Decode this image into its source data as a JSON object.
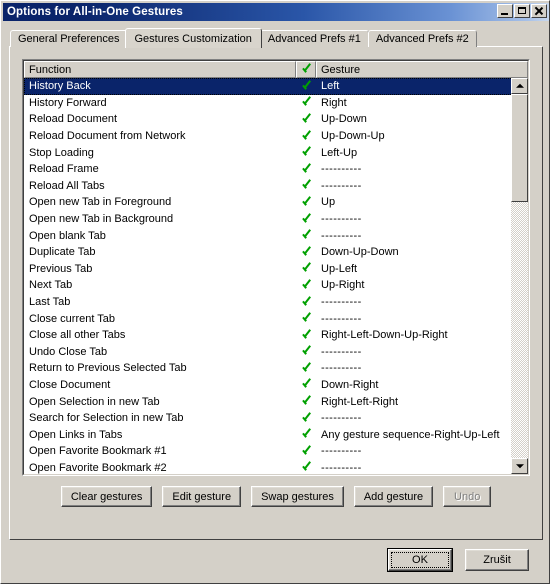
{
  "window": {
    "title": "Options for All-in-One Gestures",
    "controls": {
      "minimize": "Minimize",
      "maximize": "Maximize",
      "close": "Close"
    }
  },
  "tabs": [
    {
      "label": "General Preferences",
      "active": false
    },
    {
      "label": "Gestures Customization",
      "active": true
    },
    {
      "label": "Advanced Prefs #1",
      "active": false
    },
    {
      "label": "Advanced Prefs #2",
      "active": false
    }
  ],
  "list": {
    "columns": {
      "function": "Function",
      "enabled_icon": "check-icon",
      "gesture": "Gesture"
    },
    "placeholder_gesture": "----------",
    "rows": [
      {
        "function": "History Back",
        "enabled": true,
        "gesture": "Left",
        "selected": true
      },
      {
        "function": "History Forward",
        "enabled": true,
        "gesture": "Right",
        "selected": false
      },
      {
        "function": "Reload Document",
        "enabled": true,
        "gesture": "Up-Down",
        "selected": false
      },
      {
        "function": "Reload Document from Network",
        "enabled": true,
        "gesture": "Up-Down-Up",
        "selected": false
      },
      {
        "function": "Stop Loading",
        "enabled": true,
        "gesture": "Left-Up",
        "selected": false
      },
      {
        "function": "Reload Frame",
        "enabled": true,
        "gesture": "----------",
        "selected": false
      },
      {
        "function": "Reload All Tabs",
        "enabled": true,
        "gesture": "----------",
        "selected": false
      },
      {
        "function": "Open new Tab in Foreground",
        "enabled": true,
        "gesture": "Up",
        "selected": false
      },
      {
        "function": "Open new Tab in Background",
        "enabled": true,
        "gesture": "----------",
        "selected": false
      },
      {
        "function": "Open blank Tab",
        "enabled": true,
        "gesture": "----------",
        "selected": false
      },
      {
        "function": "Duplicate Tab",
        "enabled": true,
        "gesture": "Down-Up-Down",
        "selected": false
      },
      {
        "function": "Previous Tab",
        "enabled": true,
        "gesture": "Up-Left",
        "selected": false
      },
      {
        "function": "Next Tab",
        "enabled": true,
        "gesture": "Up-Right",
        "selected": false
      },
      {
        "function": "Last Tab",
        "enabled": true,
        "gesture": "----------",
        "selected": false
      },
      {
        "function": "Close current Tab",
        "enabled": true,
        "gesture": "----------",
        "selected": false
      },
      {
        "function": "Close all other Tabs",
        "enabled": true,
        "gesture": "Right-Left-Down-Up-Right",
        "selected": false
      },
      {
        "function": "Undo Close Tab",
        "enabled": true,
        "gesture": "----------",
        "selected": false
      },
      {
        "function": "Return to Previous Selected Tab",
        "enabled": true,
        "gesture": "----------",
        "selected": false
      },
      {
        "function": "Close Document",
        "enabled": true,
        "gesture": "Down-Right",
        "selected": false
      },
      {
        "function": "Open Selection in new Tab",
        "enabled": true,
        "gesture": "Right-Left-Right",
        "selected": false
      },
      {
        "function": "Search for Selection in new Tab",
        "enabled": true,
        "gesture": "----------",
        "selected": false
      },
      {
        "function": "Open Links in Tabs",
        "enabled": true,
        "gesture": "Any gesture sequence-Right-Up-Left",
        "selected": false
      },
      {
        "function": "Open Favorite Bookmark #1",
        "enabled": true,
        "gesture": "----------",
        "selected": false
      },
      {
        "function": "Open Favorite Bookmark #2",
        "enabled": true,
        "gesture": "----------",
        "selected": false
      }
    ]
  },
  "actions": [
    {
      "label": "Clear gestures",
      "disabled": false
    },
    {
      "label": "Edit gesture",
      "disabled": false
    },
    {
      "label": "Swap gestures",
      "disabled": false
    },
    {
      "label": "Add gesture",
      "disabled": false
    },
    {
      "label": "Undo",
      "disabled": true
    }
  ],
  "footer": {
    "ok": "OK",
    "cancel": "Zrušit"
  },
  "colors": {
    "selection": "#0a246a",
    "check": "#00a000",
    "face": "#d4d0c8",
    "titlebar_start": "#0a246a"
  }
}
